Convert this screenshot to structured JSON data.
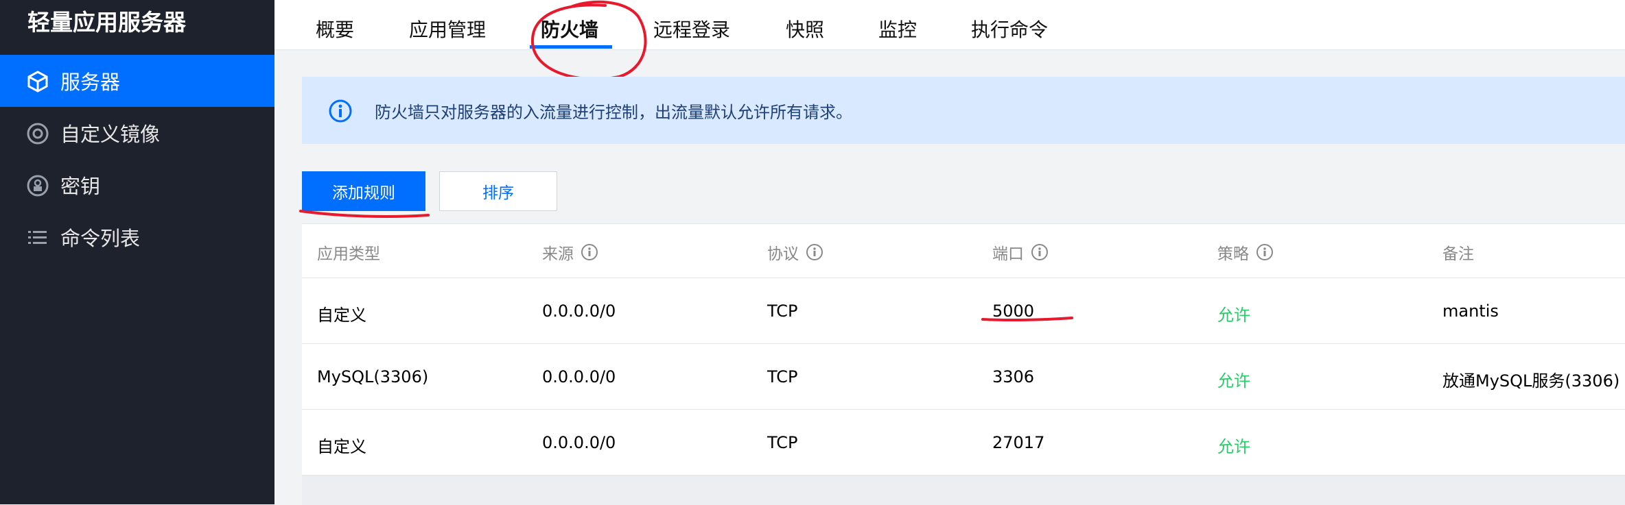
{
  "sidebar": {
    "title": "轻量应用服务器",
    "items": [
      {
        "label": "服务器",
        "icon": "cube-icon",
        "active": true
      },
      {
        "label": "自定义镜像",
        "icon": "disc-icon",
        "active": false
      },
      {
        "label": "密钥",
        "icon": "key-icon",
        "active": false
      },
      {
        "label": "命令列表",
        "icon": "list-icon",
        "active": false
      }
    ]
  },
  "tabs": [
    {
      "label": "概要"
    },
    {
      "label": "应用管理"
    },
    {
      "label": "防火墙",
      "active": true
    },
    {
      "label": "远程登录"
    },
    {
      "label": "快照"
    },
    {
      "label": "监控"
    },
    {
      "label": "执行命令"
    }
  ],
  "notice": {
    "icon": "info-icon",
    "text": "防火墙只对服务器的入流量进行控制，出流量默认允许所有请求。"
  },
  "actions": {
    "add_rule": "添加规则",
    "sort": "排序"
  },
  "table": {
    "columns": [
      "应用类型",
      "来源",
      "协议",
      "端口",
      "策略",
      "备注"
    ],
    "rows": [
      {
        "type": "自定义",
        "source": "0.0.0.0/0",
        "protocol": "TCP",
        "port": "5000",
        "policy": "允许",
        "note": "mantis"
      },
      {
        "type": "MySQL(3306)",
        "source": "0.0.0.0/0",
        "protocol": "TCP",
        "port": "3306",
        "policy": "允许",
        "note": "放通MySQL服务(3306)"
      },
      {
        "type": "自定义",
        "source": "0.0.0.0/0",
        "protocol": "TCP",
        "port": "27017",
        "policy": "允许",
        "note": ""
      }
    ]
  },
  "colors": {
    "accent": "#006eff",
    "sidebar_bg": "#1e222d",
    "allow": "#29cc6a",
    "annotation": "#e8192c"
  }
}
